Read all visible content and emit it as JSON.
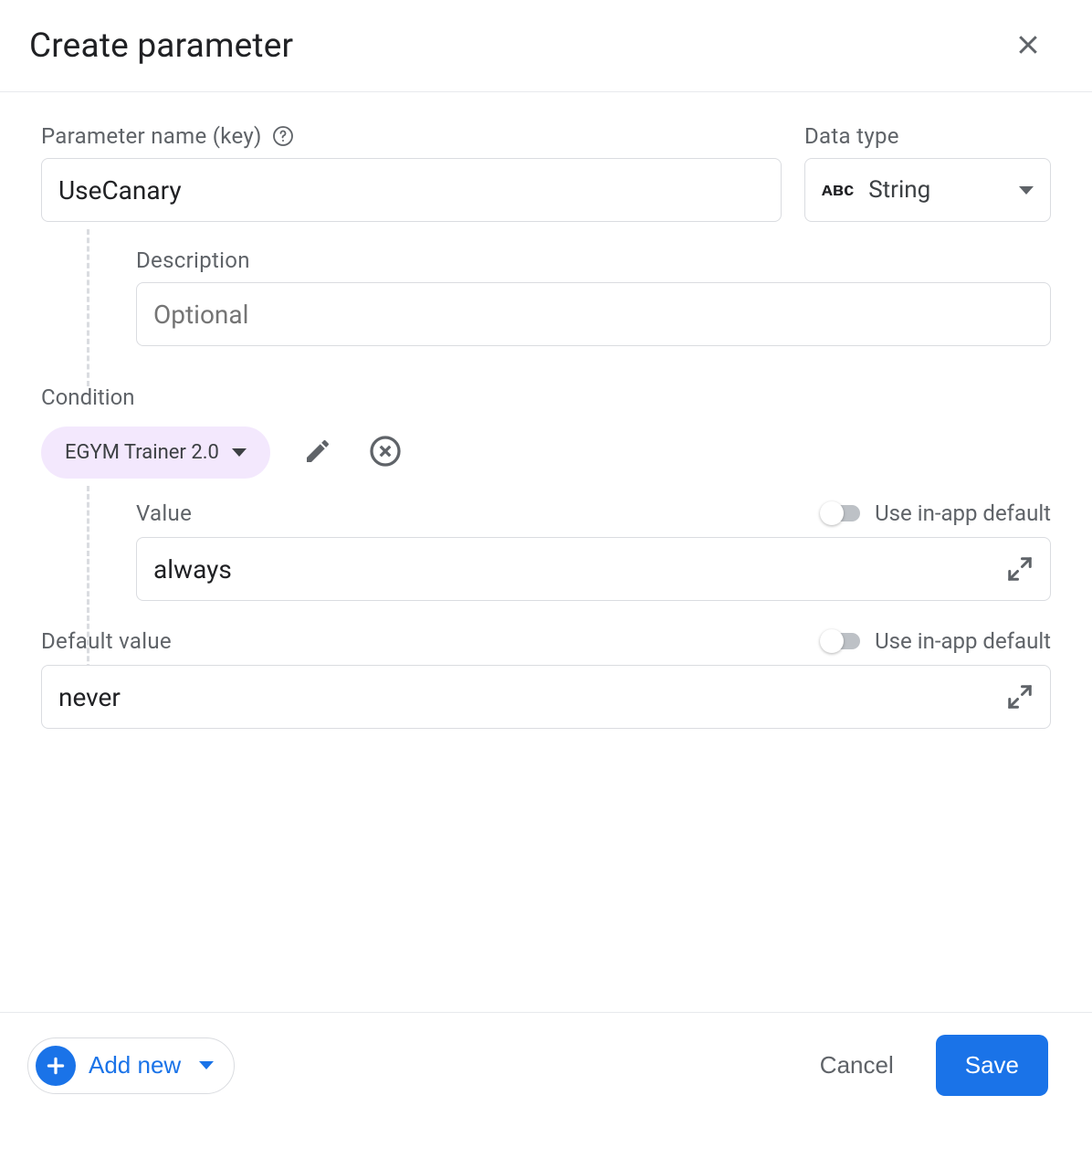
{
  "dialog": {
    "title": "Create parameter"
  },
  "param": {
    "name_label": "Parameter name (key)",
    "name_value": "UseCanary",
    "type_label": "Data type",
    "type_value": "String"
  },
  "description": {
    "label": "Description",
    "placeholder": "Optional",
    "value": ""
  },
  "condition": {
    "section_label": "Condition",
    "chip_label": "EGYM Trainer 2.0",
    "value_label": "Value",
    "use_default_label": "Use in-app default",
    "value": "always"
  },
  "default": {
    "label": "Default value",
    "use_default_label": "Use in-app default",
    "value": "never"
  },
  "footer": {
    "add_new_label": "Add new",
    "cancel_label": "Cancel",
    "save_label": "Save"
  }
}
